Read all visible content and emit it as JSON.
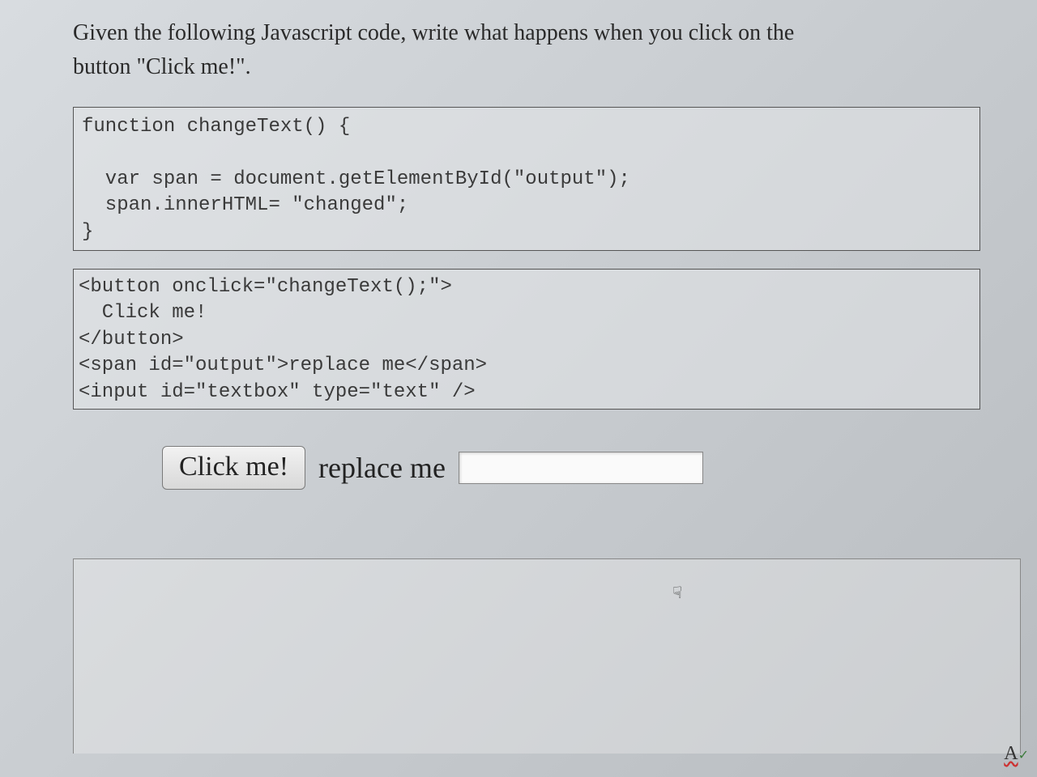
{
  "question": {
    "line1": "Given the following Javascript code, write what happens when you click on the",
    "line2": "button \"Click me!\"."
  },
  "code_block_1": "function changeText() {\n\n  var span = document.getElementById(\"output\");\n  span.innerHTML= \"changed\";\n}",
  "code_block_2": "<button onclick=\"changeText();\">\n  Click me!\n</button>\n<span id=\"output\">replace me</span>\n<input id=\"textbox\" type=\"text\" />",
  "rendered": {
    "button_label": "Click me!",
    "span_text": "replace me",
    "input_value": ""
  },
  "icons": {
    "cursor": "☟",
    "spellcheck_a": "A",
    "spellcheck_check": "✓"
  }
}
